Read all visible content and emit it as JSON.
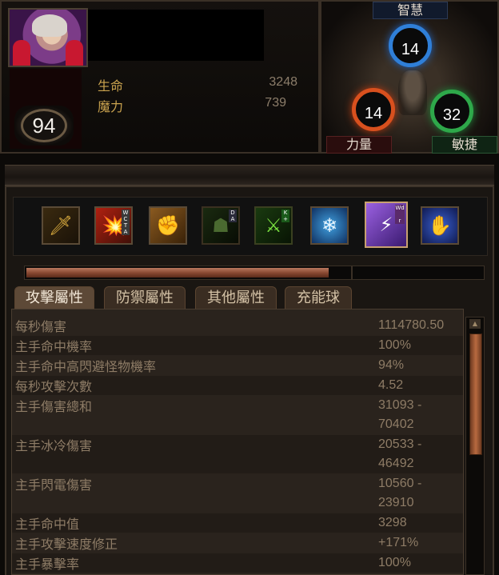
{
  "character": {
    "level": "94",
    "stats": [
      {
        "label": "生命",
        "value": "3248"
      },
      {
        "label": "魔力",
        "value": "739"
      }
    ]
  },
  "attributes": {
    "intelligence": {
      "label": "智慧",
      "value": "14"
    },
    "strength": {
      "label": "力量",
      "value": "14"
    },
    "dexterity": {
      "label": "敏捷",
      "value": "32"
    }
  },
  "skills": [
    {
      "icon": "dagger-icon",
      "glyph": "🗡",
      "runes": ""
    },
    {
      "icon": "fire-explosion-icon",
      "glyph": "💥",
      "runes": "W\nC\nT\nA"
    },
    {
      "icon": "fist-icon",
      "glyph": "✊",
      "runes": ""
    },
    {
      "icon": "shadow-figure-icon",
      "glyph": "☗",
      "runes": "D\nA"
    },
    {
      "icon": "green-blade-icon",
      "glyph": "⚔",
      "runes": "K\n+"
    },
    {
      "icon": "frost-sigil-icon",
      "glyph": "❄",
      "runes": ""
    },
    {
      "icon": "lightning-bolt-icon",
      "glyph": "⚡",
      "runes": "Wd\n\nr"
    },
    {
      "icon": "arcane-hand-icon",
      "glyph": "✋",
      "runes": ""
    }
  ],
  "progress": {
    "fill": 0.66
  },
  "tabs": [
    {
      "label": "攻擊屬性",
      "active": true
    },
    {
      "label": "防禦屬性",
      "active": false
    },
    {
      "label": "其他屬性",
      "active": false
    },
    {
      "label": "充能球",
      "active": false
    }
  ],
  "stats_table": [
    {
      "label": "每秒傷害",
      "value": "1114780.50"
    },
    {
      "label": "主手命中機率",
      "value": "100%"
    },
    {
      "label": "主手命中高閃避怪物機率",
      "value": "94%"
    },
    {
      "label": "每秒攻擊次數",
      "value": "4.52"
    },
    {
      "label": "主手傷害總和",
      "value": "31093 -\n70402"
    },
    {
      "label": "主手冰冷傷害",
      "value": "20533 -\n46492"
    },
    {
      "label": "主手閃電傷害",
      "value": "10560 -\n23910"
    },
    {
      "label": "主手命中值",
      "value": "3298"
    },
    {
      "label": "主手攻擊速度修正",
      "value": "+171%"
    },
    {
      "label": "主手暴擊率",
      "value": "100%"
    }
  ],
  "colors": {
    "intelligence": "#2f7fd8",
    "strength": "#d8501e",
    "dexterity": "#2ea84a",
    "label_gold": "#c9a24e"
  }
}
